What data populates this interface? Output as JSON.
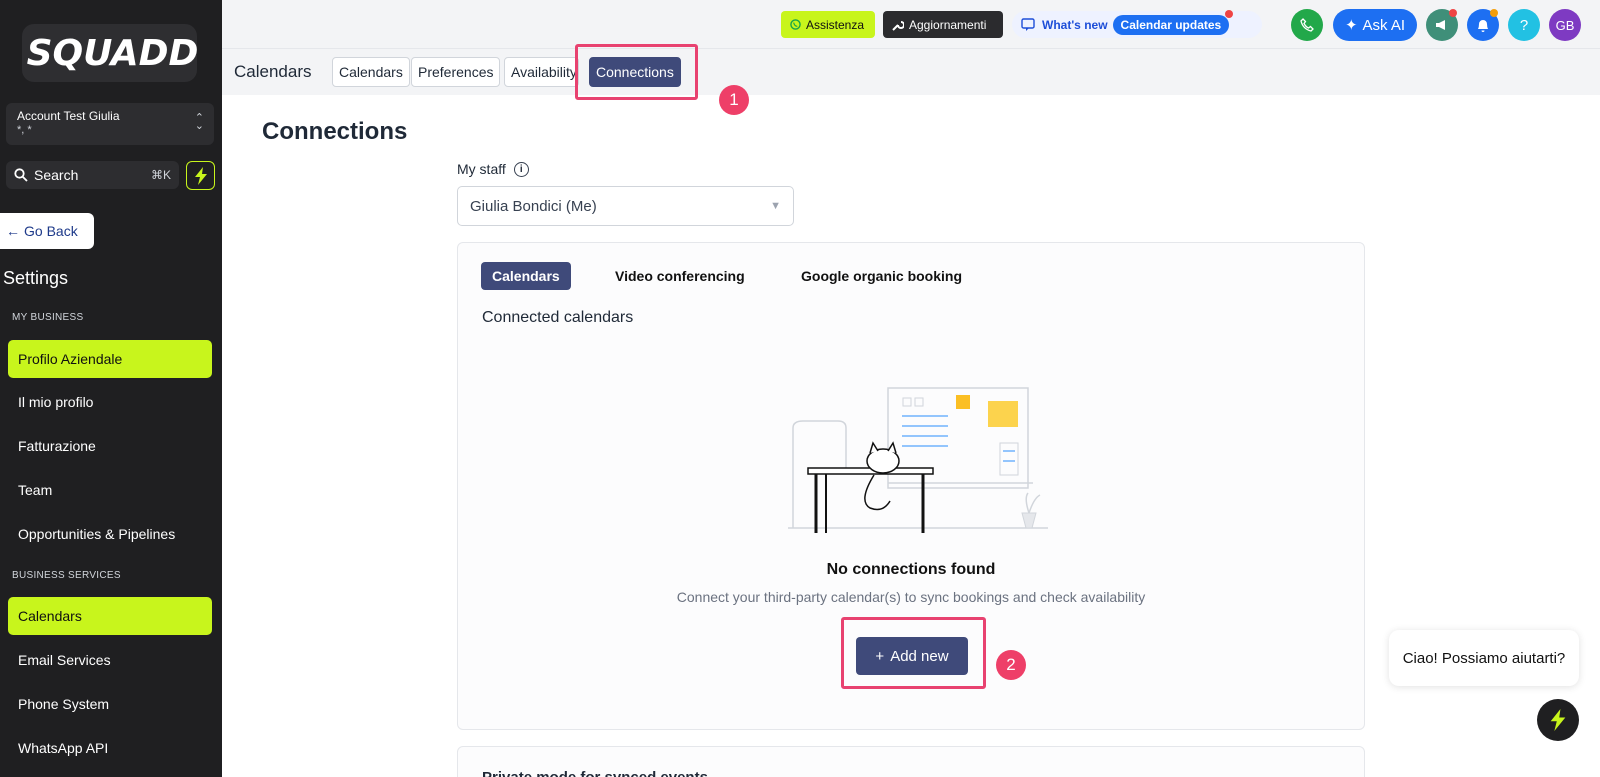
{
  "sidebar": {
    "logo_text": "SQUADD",
    "account_name": "Account Test Giulia",
    "account_sub": "*, *",
    "search_label": "Search",
    "search_shortcut": "⌘K",
    "go_back": "Go Back",
    "settings_title": "Settings",
    "section_my_business": "MY BUSINESS",
    "section_business_services": "BUSINESS SERVICES",
    "items": [
      {
        "label": "Profilo Aziendale"
      },
      {
        "label": "Il mio profilo"
      },
      {
        "label": "Fatturazione"
      },
      {
        "label": "Team"
      },
      {
        "label": "Opportunities & Pipelines"
      },
      {
        "label": "Calendars"
      },
      {
        "label": "Email Services"
      },
      {
        "label": "Phone System"
      },
      {
        "label": "WhatsApp API"
      }
    ]
  },
  "topbar": {
    "assistenza": "Assistenza",
    "aggiornamenti": "Aggiornamenti",
    "whats_new": "What's new",
    "calendar_updates": "Calendar updates",
    "ask_ai": "Ask AI",
    "help": "?",
    "avatar_initials": "GB"
  },
  "subbar": {
    "title": "Calendars",
    "tabs": [
      {
        "label": "Calendars"
      },
      {
        "label": "Preferences"
      },
      {
        "label": "Availability"
      },
      {
        "label": "Connections"
      }
    ]
  },
  "annotations": {
    "step1": "1",
    "step2": "2"
  },
  "main": {
    "page_title": "Connections",
    "staff_label": "My staff",
    "staff_value": "Giulia Bondici (Me)",
    "card": {
      "tabs": [
        {
          "label": "Calendars"
        },
        {
          "label": "Video conferencing"
        },
        {
          "label": "Google organic booking"
        }
      ],
      "subtitle": "Connected calendars",
      "empty_title": "No connections found",
      "empty_desc": "Connect your third-party calendar(s) to sync bookings and check availability",
      "add_new": "Add new"
    },
    "card2_title": "Private mode for synced events"
  },
  "chat": {
    "bubble": "Ciao! Possiamo aiutarti?"
  },
  "colors": {
    "accent_lime": "#c8f51c",
    "primary_navy": "#3f4a7a",
    "highlight_pink": "#e84270",
    "sidebar_bg": "#1f1f21"
  }
}
